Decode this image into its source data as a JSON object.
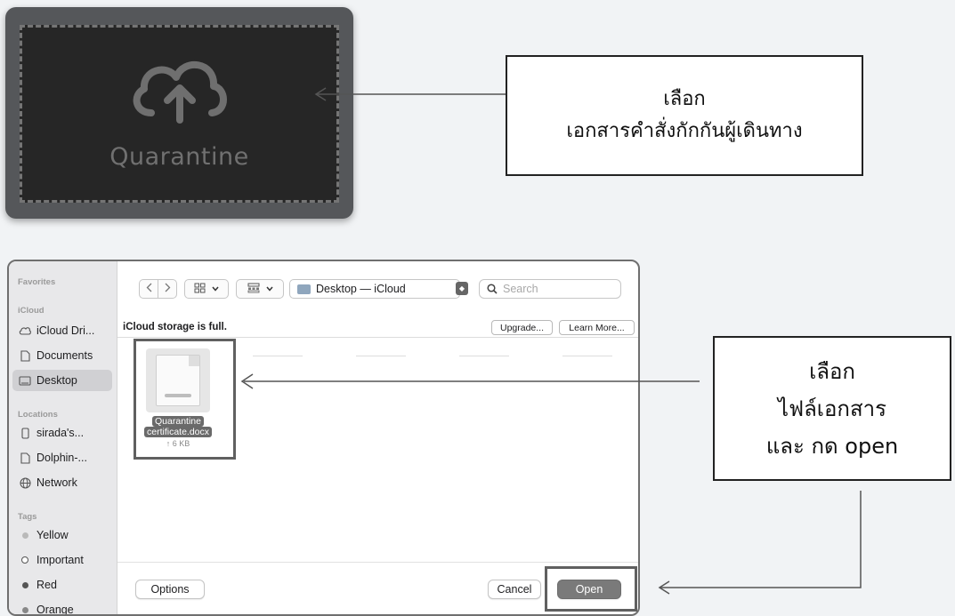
{
  "upload_card": {
    "label": "Quarantine",
    "icon": "cloud-upload-icon"
  },
  "callout_1": {
    "line1": "เลือก",
    "line2": "เอกสารคำสั่งกักกันผู้เดินทาง"
  },
  "callout_2": {
    "line1": "เลือก",
    "line2": "ไฟล์เอกสาร",
    "line3": "และ กด open"
  },
  "dialog": {
    "sidebar": {
      "favorites_header": "Favorites",
      "icloud_header": "iCloud",
      "icloud_items": [
        {
          "label": "iCloud Dri...",
          "icon": "cloud-icon"
        },
        {
          "label": "Documents",
          "icon": "document-icon"
        },
        {
          "label": "Desktop",
          "icon": "desktop-icon",
          "selected": true
        }
      ],
      "locations_header": "Locations",
      "location_items": [
        {
          "label": "sirada's...",
          "icon": "phone-icon"
        },
        {
          "label": "Dolphin-...",
          "icon": "document-icon"
        },
        {
          "label": "Network",
          "icon": "globe-icon"
        }
      ],
      "tags_header": "Tags",
      "tags": [
        {
          "label": "Yellow",
          "color": "#b9b9b9"
        },
        {
          "label": "Important",
          "color": "#ffffff"
        },
        {
          "label": "Red",
          "color": "#555555"
        },
        {
          "label": "Orange",
          "color": "#888888"
        }
      ]
    },
    "toolbar": {
      "back_icon": "chevron-left-icon",
      "forward_icon": "chevron-right-icon",
      "view_icon": "grid-icon",
      "group_icon": "group-icon",
      "location": "Desktop — iCloud",
      "search_placeholder": "Search"
    },
    "banner": {
      "text": "iCloud storage is full.",
      "upgrade_label": "Upgrade...",
      "learn_more_label": "Learn More..."
    },
    "file": {
      "name_line1": "Quarantine",
      "name_line2": "certificate.docx",
      "size": "↑ 6 KB"
    },
    "options_label": "Options",
    "cancel_label": "Cancel",
    "open_label": "Open"
  }
}
